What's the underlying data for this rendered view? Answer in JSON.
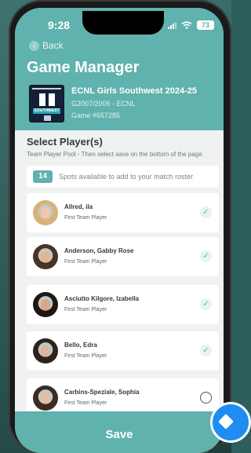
{
  "status_bar": {
    "time": "9:28",
    "battery": "73"
  },
  "nav": {
    "back_label": "Back"
  },
  "page": {
    "title": "Game Manager"
  },
  "team": {
    "name": "ECNL Girls Southwest 2024-25",
    "group": "G2007/2006 - ECNL",
    "game": "Game #657285",
    "logo_text": "SOUTHWEST"
  },
  "section": {
    "title": "Select Player(s)",
    "subtitle": "Team Player Pool - Then select save on the bottom of the page."
  },
  "spots": {
    "count": "14",
    "text": "Spots available to add to your match roster"
  },
  "players": [
    {
      "name": "Allred, ila",
      "role": "First Team Player",
      "selected": true,
      "hair": "#d9b27a",
      "skin": "#efc9ae"
    },
    {
      "name": "Anderson, Gabby Rose",
      "role": "First Team Player",
      "selected": true,
      "hair": "#4b3424",
      "skin": "#e2b693"
    },
    {
      "name": "Asciutto Kilgore, Izabella",
      "role": "First Team Player",
      "selected": true,
      "hair": "#1d1714",
      "skin": "#d9a887"
    },
    {
      "name": "Bello, Edra",
      "role": "First Team Player",
      "selected": true,
      "hair": "#2a2420",
      "skin": "#e0b69b"
    },
    {
      "name": "Carbins-Speziale, Sophia",
      "role": "First Team Player",
      "selected": false,
      "hair": "#3b2b22",
      "skin": "#e7bea3"
    }
  ],
  "footer": {
    "save_label": "Save"
  },
  "colors": {
    "accent": "#5fb2ad",
    "fab": "#1e8cf0"
  }
}
